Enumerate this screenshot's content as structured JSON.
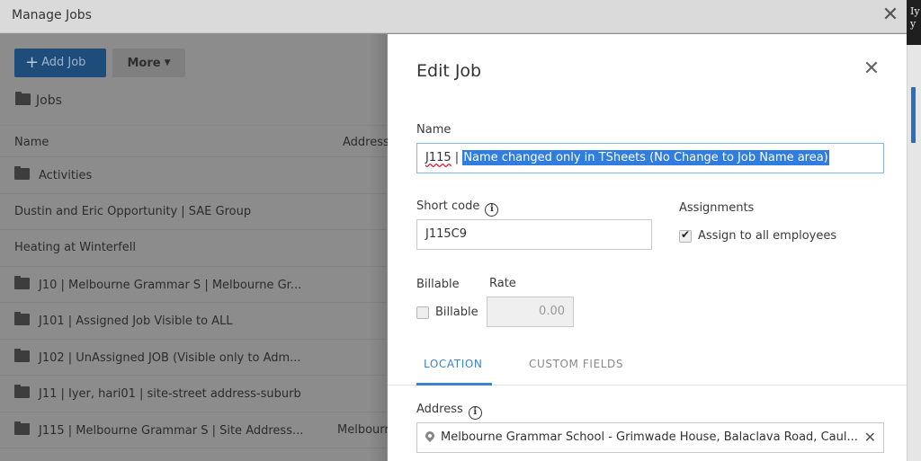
{
  "window": {
    "title": "Manage Jobs",
    "close_icon": "close-icon"
  },
  "toolbar": {
    "add_job_label": "Add Job",
    "more_label": "More"
  },
  "breadcrumb": {
    "label": "Jobs"
  },
  "table": {
    "columns": [
      "Name",
      "Address"
    ],
    "rows": [
      {
        "name": "Activities",
        "folder": true,
        "address": ""
      },
      {
        "name": "Dustin and Eric Opportunity | SAE Group",
        "folder": false,
        "address": ""
      },
      {
        "name": "Heating at Winterfell",
        "folder": false,
        "address": ""
      },
      {
        "name": "J10 | Melbourne Grammar S | Melbourne Gr...",
        "folder": true,
        "address": ""
      },
      {
        "name": "J101 | Assigned Job Visible to ALL",
        "folder": true,
        "address": ""
      },
      {
        "name": "J102 | UnAssigned JOB (Visible only to Adm...",
        "folder": true,
        "address": ""
      },
      {
        "name": "J11 | Iyer, hari01 | site-street address-suburb",
        "folder": true,
        "address": ""
      },
      {
        "name": "J115 | Melbourne Grammar S | Site Address...",
        "folder": true,
        "address": "Melbourne"
      }
    ]
  },
  "dialog": {
    "title": "Edit Job",
    "name_label": "Name",
    "name_prefix": "J115",
    "name_sep": " | ",
    "name_selected": "Name changed only in TSheets (No Change to Job Name area)",
    "short_code_label": "Short code",
    "short_code_value": "J115C9",
    "assignments_label": "Assignments",
    "assign_all_label": "Assign to all employees",
    "assign_all_checked": true,
    "billable_label": "Billable",
    "billable_checkbox_label": "Billable",
    "billable_checked": false,
    "rate_label": "Rate",
    "rate_value": "0.00",
    "tabs": [
      {
        "label": "LOCATION",
        "active": true
      },
      {
        "label": "CUSTOM FIELDS",
        "active": false
      }
    ],
    "address_label": "Address",
    "address_value": "Melbourne Grammar School - Grimwade House, Balaclava Road, Caul..."
  },
  "background_window": {
    "visible_text": "Iy\ny"
  }
}
